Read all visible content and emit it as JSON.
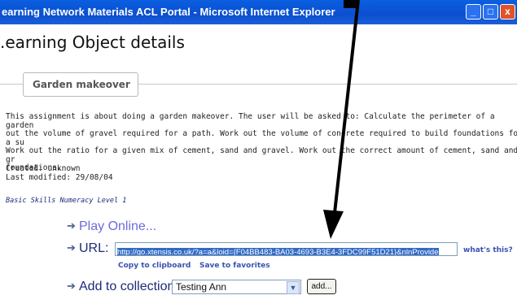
{
  "window": {
    "title": "earning Network Materials ACL Portal - Microsoft Internet Explorer",
    "min_glyph": "_",
    "max_glyph": "□",
    "close_glyph": "x"
  },
  "page": {
    "title": ".earning Object details"
  },
  "tab": {
    "label": "Garden makeover"
  },
  "description": {
    "lines": [
      "This assignment is about doing a garden makeover. The user will be asked to: Calculate the perimeter of a garden",
      "out the volume of gravel required for a path. Work out the volume of concrete required to build foundations for a su",
      "Work out the ratio for a given mix of cement, sand and gravel. Work out the correct amount of cement, sand and gr",
      "foundations."
    ]
  },
  "meta": {
    "created": "Created: unknown",
    "modified": "Last modified: 29/08/04"
  },
  "level": "Basic Skills Numeracy Level 1",
  "actions": {
    "play_online": "Play Online...",
    "url_label": "URL:",
    "url_value": "http://go.xtensis.co.uk/?a=a&loid={F04BB483-BA03-4693-B3E4-3FDC99F51D21}&nlnProvide",
    "whats_this": "what's this?",
    "copy_clipboard": "Copy to clipboard",
    "save_favorites": "Save to favorites",
    "add_collection_label": "Add to collection:",
    "collection_selected": "Testing Ann",
    "add_button": "add..."
  },
  "colors": {
    "titlebar": "#0b4fd0",
    "link": "#3a52b0",
    "selection": "#316ac5"
  }
}
